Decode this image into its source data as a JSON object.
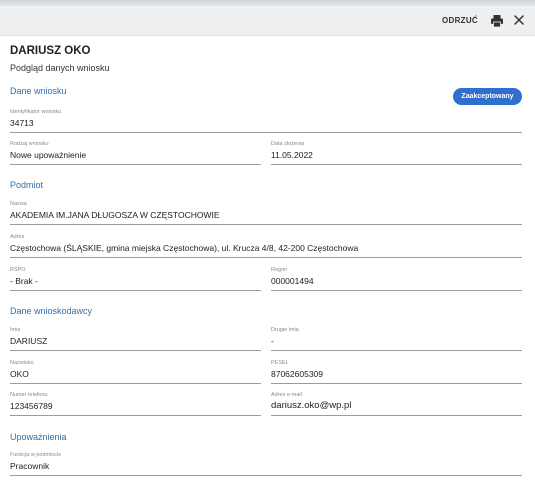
{
  "toolbar": {
    "discard_label": "ODRZUĆ",
    "print_icon": "printer-icon",
    "close_icon": "close-icon"
  },
  "header": {
    "title": "DARIUSZ OKO",
    "subtitle": "Podgląd danych wniosku"
  },
  "status": {
    "label": "Zaakceptowany",
    "color": "#2f6fcf"
  },
  "sections": {
    "application": "Dane wniosku",
    "entity": "Podmiot",
    "applicant": "Dane wnioskodawcy",
    "authorization": "Upoważnienia"
  },
  "fields": {
    "application_id": {
      "label": "Identyfikator wniosku",
      "value": "34713"
    },
    "application_type": {
      "label": "Rodzaj wniosku",
      "value": "Nowe upoważnienie"
    },
    "submission_date": {
      "label": "Data złożenia",
      "value": "11.05.2022"
    },
    "entity_name": {
      "label": "Nazwa",
      "value": "AKADEMIA IM.JANA DŁUGOSZA W CZĘSTOCHOWIE"
    },
    "entity_address": {
      "label": "Adres",
      "value": "Częstochowa (ŚLĄSKIE, gmina miejska Częstochowa), ul. Krucza 4/8, 42-200 Częstochowa"
    },
    "rspo": {
      "label": "RSPO",
      "value": "- Brak -"
    },
    "regon": {
      "label": "Regon",
      "value": "000001494"
    },
    "first_name": {
      "label": "Imię",
      "value": "DARIUSZ"
    },
    "second_name": {
      "label": "Drugie imię",
      "value": "-"
    },
    "last_name": {
      "label": "Nazwisko",
      "value": "OKO"
    },
    "pesel": {
      "label": "PESEL",
      "value": "87062605309"
    },
    "phone": {
      "label": "Numer telefonu",
      "value": "123456789"
    },
    "email": {
      "label": "Adres e-mail",
      "value": "dariusz.oko@wp.pl"
    },
    "function": {
      "label": "Funkcja w podmiocie",
      "value": "Pracownik"
    }
  },
  "colors": {
    "accent": "#2f6fa8",
    "badge": "#2f6fcf"
  }
}
